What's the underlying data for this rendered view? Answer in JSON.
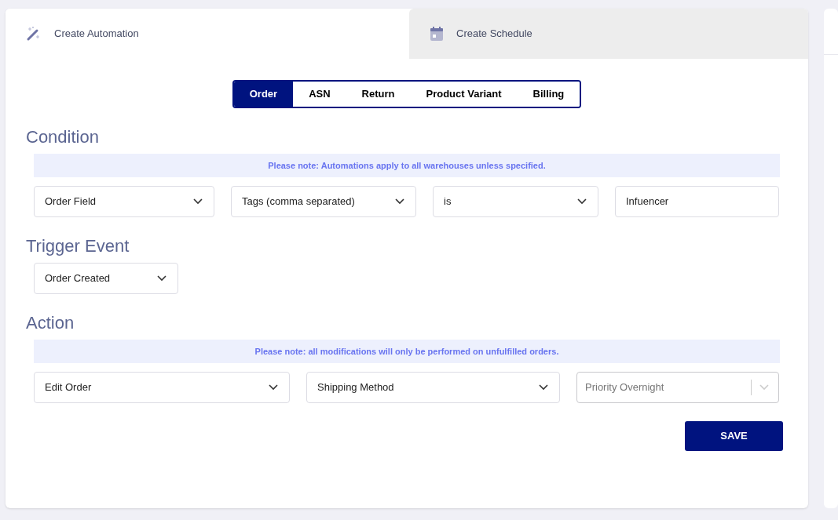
{
  "tabs": [
    {
      "label": "Create Automation",
      "selected": true
    },
    {
      "label": "Create Schedule",
      "selected": false
    }
  ],
  "segments": [
    {
      "label": "Order",
      "selected": true
    },
    {
      "label": "ASN",
      "selected": false
    },
    {
      "label": "Return",
      "selected": false
    },
    {
      "label": "Product Variant",
      "selected": false
    },
    {
      "label": "Billing",
      "selected": false
    }
  ],
  "sections": [
    {
      "title": "Condition",
      "note": "Please note: Automations apply to all warehouses unless specified.",
      "fields": [
        {
          "kind": "select",
          "value": "Order Field"
        },
        {
          "kind": "select",
          "value": "Tags (comma separated)"
        },
        {
          "kind": "select",
          "value": "is"
        },
        {
          "kind": "input",
          "value": "Infuencer"
        }
      ]
    },
    {
      "title": "Trigger Event",
      "fields": [
        {
          "kind": "select",
          "value": "Order Created"
        }
      ]
    },
    {
      "title": "Action",
      "note": "Please note: all modifications will only be performed on unfulfilled orders.",
      "fields": [
        {
          "kind": "select",
          "value": "Edit Order"
        },
        {
          "kind": "select",
          "value": "Shipping Method"
        },
        {
          "kind": "muted-select",
          "value": "Priority Overnight"
        }
      ]
    }
  ],
  "save_label": "SAVE"
}
